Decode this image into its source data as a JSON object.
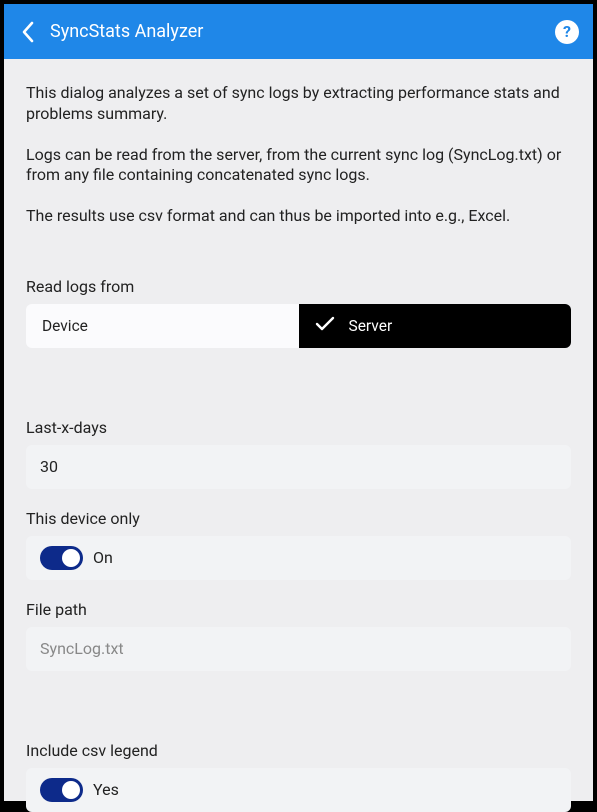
{
  "header": {
    "title": "SyncStats Analyzer"
  },
  "description": {
    "p1": "This dialog analyzes a set of sync logs by extracting performance stats and problems summary.",
    "p2": "Logs can be read from the server, from the current sync log (SyncLog.txt) or from any file containing concatenated sync logs.",
    "p3": "The results use csv format and can thus be imported into e.g., Excel."
  },
  "read_logs": {
    "label": "Read logs from",
    "options": {
      "device": "Device",
      "server": "Server"
    },
    "selected": "server"
  },
  "last_x_days": {
    "label": "Last-x-days",
    "value": "30"
  },
  "device_only": {
    "label": "This device only",
    "text": "On"
  },
  "file_path": {
    "label": "File path",
    "placeholder": "SyncLog.txt"
  },
  "csv_legend": {
    "label": "Include csv legend",
    "text": "Yes"
  }
}
